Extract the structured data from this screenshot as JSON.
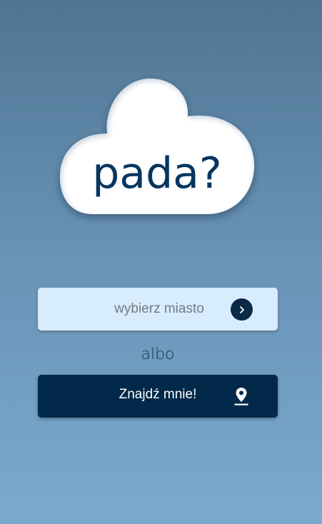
{
  "logo": {
    "text": "pada?",
    "icon": "cloud-icon"
  },
  "search": {
    "placeholder": "wybierz miasto",
    "value": "",
    "submit_icon": "chevron-right-icon"
  },
  "separator": {
    "text": "albo"
  },
  "locate": {
    "label": "Znajdź mnie!",
    "icon": "location-pin-icon"
  },
  "colors": {
    "background_top": "#4f7592",
    "background_bottom": "#7aaacf",
    "input_bg": "#d7ecfd",
    "primary_dark": "#02284a",
    "logo_text": "#063660"
  }
}
